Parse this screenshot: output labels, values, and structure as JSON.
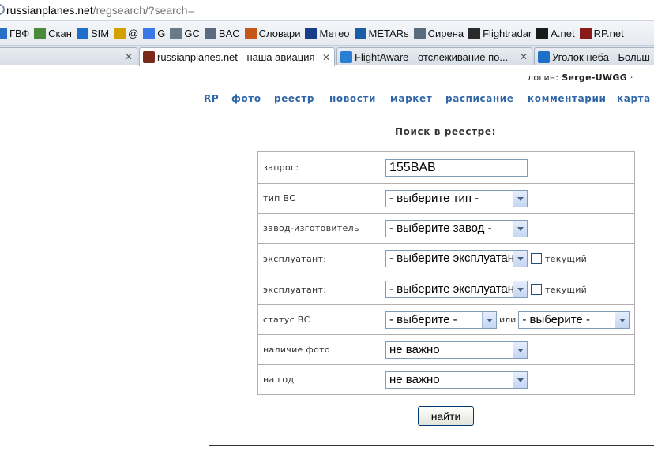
{
  "address_bar": {
    "host": "russianplanes.net",
    "path": "/regsearch/?search="
  },
  "bookmarks": [
    {
      "label": "ГВФ",
      "icon": "gvf-icon",
      "color": "#2a6fc4"
    },
    {
      "label": "Скан",
      "icon": "scan-icon",
      "color": "#4a8a3a"
    },
    {
      "label": "SIM",
      "icon": "plane-sim-icon",
      "color": "#1e6fc8"
    },
    {
      "label": "@",
      "icon": "mail-icon",
      "color": "#d4a000"
    },
    {
      "label": "G",
      "icon": "google-icon",
      "color": "#3b78e7"
    },
    {
      "label": "GC",
      "icon": "gc-icon",
      "color": "#6a7a8a"
    },
    {
      "label": "BAC",
      "icon": "plane-icon",
      "color": "#5a6b80"
    },
    {
      "label": "Словари",
      "icon": "bars-icon",
      "color": "#c8561a"
    },
    {
      "label": "Метео",
      "icon": "meteo-icon",
      "color": "#1a3c8a"
    },
    {
      "label": "METARs",
      "icon": "noaa-icon",
      "color": "#1a5ea8"
    },
    {
      "label": "Сирена",
      "icon": "plane-icon",
      "color": "#5a6b80"
    },
    {
      "label": "Flightradar",
      "icon": "globe-icon",
      "color": "#2a2a2a"
    },
    {
      "label": "A.net",
      "icon": "anet-icon",
      "color": "#1a1a1a"
    },
    {
      "label": "RP.net",
      "icon": "rp-icon",
      "color": "#8a1a1a"
    }
  ],
  "tabs": [
    {
      "title": "",
      "active": false
    },
    {
      "title": "russianplanes.net - наша авиация",
      "active": true
    },
    {
      "title": "FlightAware - отслеживание по...",
      "active": false
    },
    {
      "title": "Уголок неба - Больш",
      "active": false
    }
  ],
  "login": {
    "label": "логин:",
    "user": "Serge-UWGG"
  },
  "nav": [
    "RP",
    "фото",
    "реестр",
    "новости",
    "маркет",
    "расписание",
    "комментарии",
    "карта"
  ],
  "search": {
    "title": "Поиск в реестре:",
    "rows": {
      "query": {
        "label": "запрос:",
        "value": "155BAB"
      },
      "type": {
        "label": "тип ВС",
        "selected": "- выберите тип -"
      },
      "factory": {
        "label": "завод-изготовитель",
        "selected": "- выберите завод -"
      },
      "operator1": {
        "label": "эксплуатант:",
        "selected": "- выберите эксплуатант -",
        "current_label": "текущий"
      },
      "operator2": {
        "label": "эксплуатант:",
        "selected": "- выберите эксплуатант -",
        "current_label": "текущий"
      },
      "status": {
        "label": "статус ВС",
        "selected1": "- выберите -",
        "or": "или",
        "selected2": "- выберите -"
      },
      "photo": {
        "label": "наличие фото",
        "selected": "не важно"
      },
      "year": {
        "label": "на год",
        "selected": "не важно"
      }
    },
    "submit_label": "найти"
  }
}
